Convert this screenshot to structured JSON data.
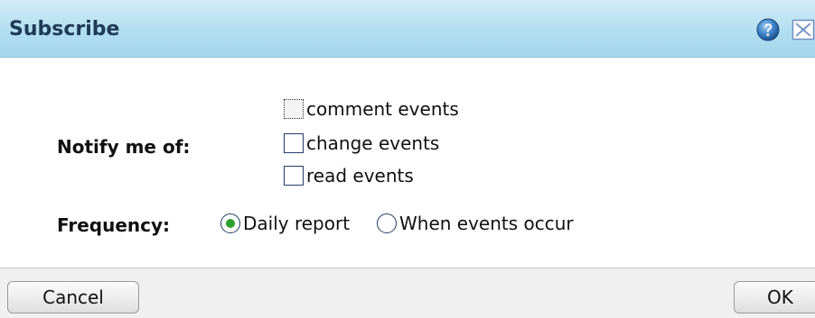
{
  "dialog": {
    "title": "Subscribe",
    "icons": {
      "help": "help-icon",
      "close": "close-icon"
    }
  },
  "notify": {
    "label": "Notify me of:",
    "options": [
      {
        "label": "comment events",
        "checked": false,
        "focused": true
      },
      {
        "label": "change events",
        "checked": false,
        "focused": false
      },
      {
        "label": "read events",
        "checked": false,
        "focused": false
      }
    ]
  },
  "frequency": {
    "label": "Frequency:",
    "options": [
      {
        "label": "Daily report",
        "selected": true
      },
      {
        "label": "When events occur",
        "selected": false
      }
    ]
  },
  "footer": {
    "cancel_label": "Cancel",
    "ok_label": "OK"
  },
  "colors": {
    "titlebar": "#b4dff0",
    "radio_selected": "#2ca22c",
    "checkbox_border": "#1f3f66"
  }
}
